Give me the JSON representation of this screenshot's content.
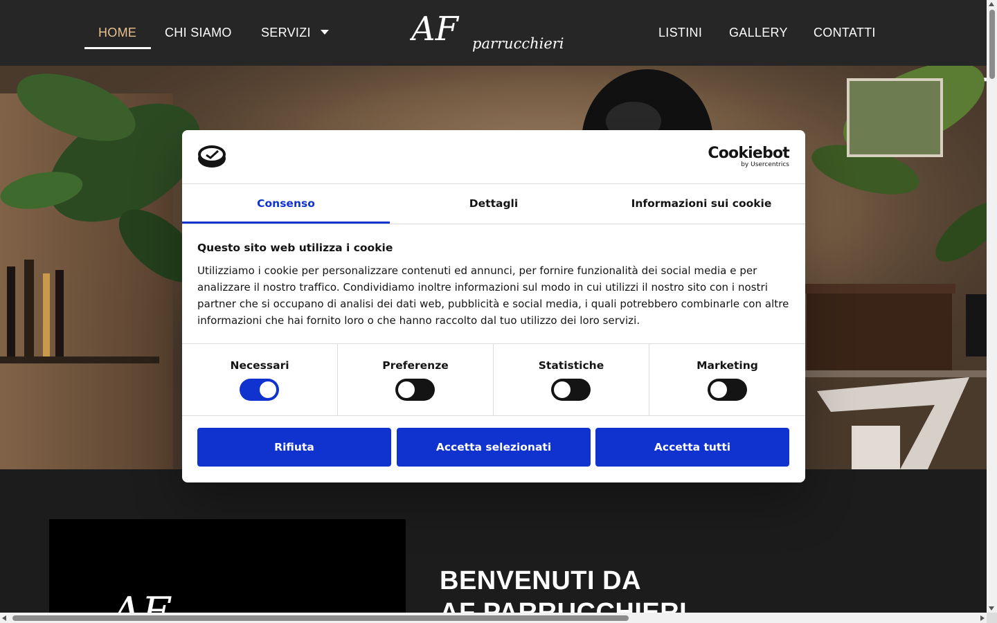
{
  "header": {
    "nav_left": [
      {
        "label": "HOME",
        "active": true
      },
      {
        "label": "CHI SIAMO"
      },
      {
        "label": "SERVIZI",
        "has_dropdown": true
      }
    ],
    "nav_right": [
      {
        "label": "LISTINI"
      },
      {
        "label": "GALLERY"
      },
      {
        "label": "CONTATTI"
      }
    ],
    "logo": {
      "monogram": "AF",
      "wordmark": "parrucchieri"
    }
  },
  "cookie_banner": {
    "brand": "Cookiebot",
    "brand_sub": "by Usercentrics",
    "tabs": [
      {
        "label": "Consenso",
        "active": true
      },
      {
        "label": "Dettagli"
      },
      {
        "label": "Informazioni sui cookie"
      }
    ],
    "title": "Questo sito web utilizza i cookie",
    "text": "Utilizziamo i cookie per personalizzare contenuti ed annunci, per fornire funzionalità dei social media e per analizzare il nostro traffico. Condividiamo inoltre informazioni sul modo in cui utilizzi il nostro sito con i nostri partner che si occupano di analisi dei dati web, pubblicità e social media, i quali potrebbero combinarle con altre informazioni che hai fornito loro o che hanno raccolto dal tuo utilizzo dei loro servizi.",
    "toggles": [
      {
        "label": "Necessari",
        "on": true
      },
      {
        "label": "Preferenze",
        "on": false
      },
      {
        "label": "Statistiche",
        "on": false
      },
      {
        "label": "Marketing",
        "on": false
      }
    ],
    "buttons": {
      "reject": "Rifiuta",
      "accept_selected": "Accetta selezionati",
      "accept_all": "Accetta tutti"
    }
  },
  "welcome": {
    "line1": "BENVENUTI DA",
    "line2": "AF PARRUCCHIERI"
  },
  "colors": {
    "accent_blue": "#1032cf",
    "active_nav": "#e6c08f",
    "header_bg": "#262626"
  }
}
